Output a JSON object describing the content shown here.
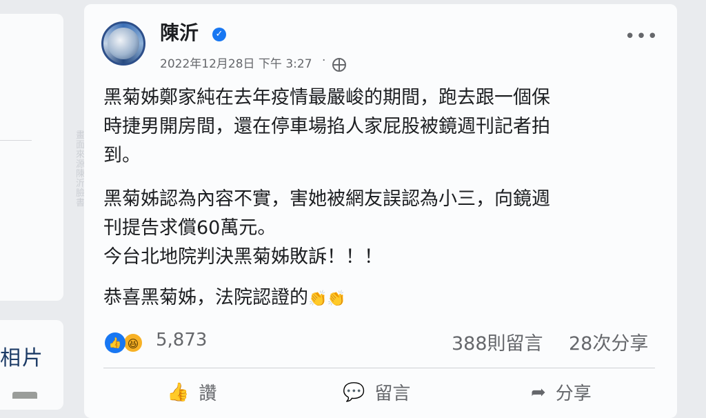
{
  "sidebar": {
    "photos_label": "相片"
  },
  "watermark": "畫面來源：陳沂　臉書",
  "post": {
    "author": "陳沂",
    "timestamp": "2022年12月28日 下午 3:27",
    "separator": "·",
    "more_label": "•••",
    "paragraphs": [
      "黑菊姊鄭家純在去年疫情最嚴峻的期間，跑去跟一個保\n時捷男開房間，還在停車場掐人家屁股被鏡週刊記者拍\n到。",
      "黑菊姊認為內容不實，害她被網友誤認為小三，向鏡週\n刊提告求償60萬元。\n今台北地院判決黑菊姊敗訴！！！",
      "恭喜黑菊姊，法院認證的"
    ],
    "emoji_suffix": "👏👏",
    "reaction_count": "5,873",
    "comments": "388則留言",
    "shares": "28次分享",
    "actions": {
      "like": "讚",
      "comment": "留言",
      "share": "分享"
    }
  }
}
